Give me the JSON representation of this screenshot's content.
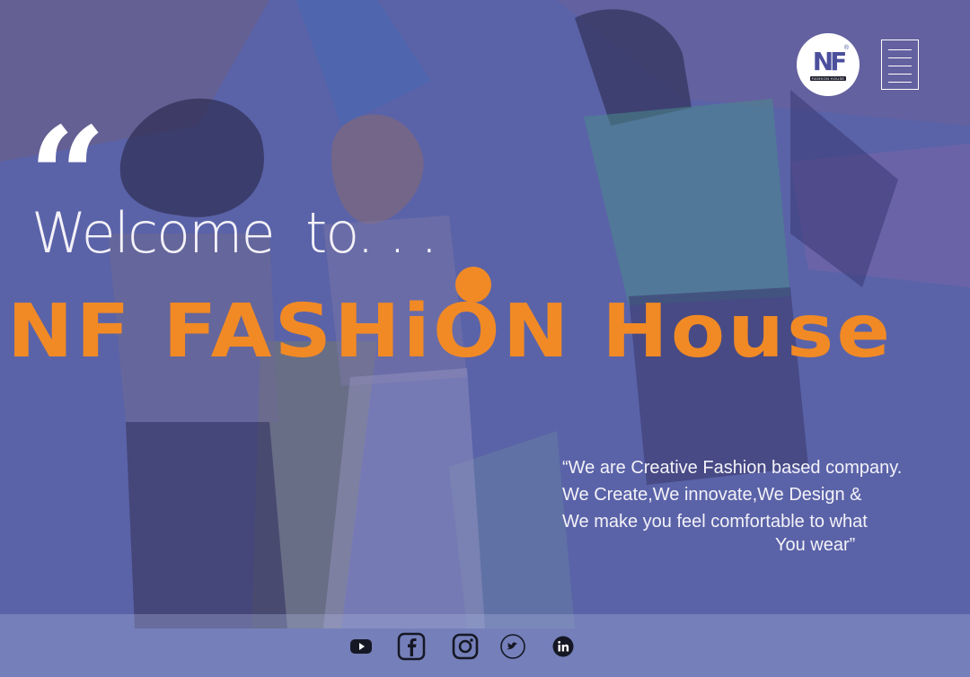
{
  "brand": {
    "logo_text": "NF",
    "logo_subtext": "FASHION HOUSE",
    "logo_reg": "®"
  },
  "hero": {
    "quote_mark": "“",
    "welcome": "Welcome  to. . .",
    "title": "NF FASHiON House"
  },
  "mission": {
    "lines": [
      "“We are Creative Fashion based company.",
      "We Create,We innovate,We Design &",
      "We make you feel comfortable to what",
      "You wear”"
    ]
  },
  "footer": {
    "social": [
      "youtube-icon",
      "facebook-icon",
      "instagram-icon",
      "twitter-icon",
      "linkedin-icon"
    ]
  },
  "colors": {
    "background": "#5a63a8",
    "brand_orange": "#f18a25",
    "text_light": "#f4f2f8",
    "icon_dark": "#151824"
  }
}
